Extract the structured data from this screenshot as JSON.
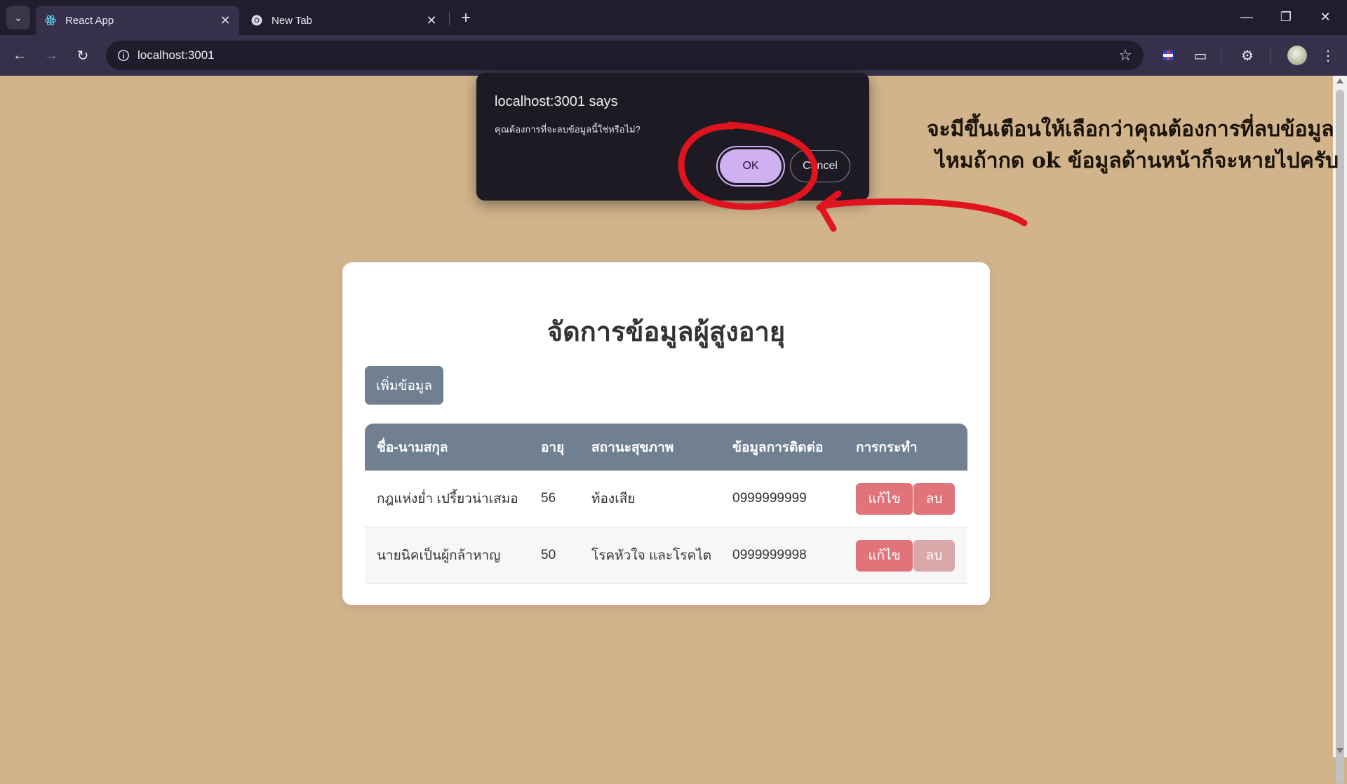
{
  "browser": {
    "tabs": [
      {
        "title": "React App",
        "active": true
      },
      {
        "title": "New Tab",
        "active": false
      }
    ],
    "url": "localhost:3001"
  },
  "dialog": {
    "title": "localhost:3001 says",
    "message": "คุณต้องการที่จะลบข้อมูลนี้ใช่หรือไม่?",
    "ok_label": "OK",
    "cancel_label": "Cancel"
  },
  "annotation": {
    "line1": "จะมีขึ้นเตือนให้เลือกว่าคุณต้องการที่ลบข้อมูล",
    "line2": "ไหมถ้ากด ok  ข้อมูลด้านหน้าก็จะหายไปครับ",
    "ink_color": "#e0141e"
  },
  "page": {
    "title": "จัดการข้อมูลผู้สูงอายุ",
    "add_button": "เพิ่มข้อมูล",
    "columns": [
      "ชื่อ-นามสกุล",
      "อายุ",
      "สถานะสุขภาพ",
      "ข้อมูลการติดต่อ",
      "การกระทำ"
    ],
    "rows": [
      {
        "name": "กฎแห่งย่ำ เปรี้ยวน่าเสมอ",
        "age": "56",
        "health": "ท้องเสีย",
        "contact": "0999999999",
        "edit": "แก้ไข",
        "delete": "ลบ"
      },
      {
        "name": "นายนิคเป็นผู้กล้าหาญ",
        "age": "50",
        "health": "โรคหัวใจ และโรคไต",
        "contact": "0999999998",
        "edit": "แก้ไข",
        "delete": "ลบ"
      }
    ]
  },
  "colors": {
    "background": "#d2b48c",
    "header": "#708090",
    "button_danger": "#e0747a",
    "dialog_ok": "#cfb1f1"
  }
}
